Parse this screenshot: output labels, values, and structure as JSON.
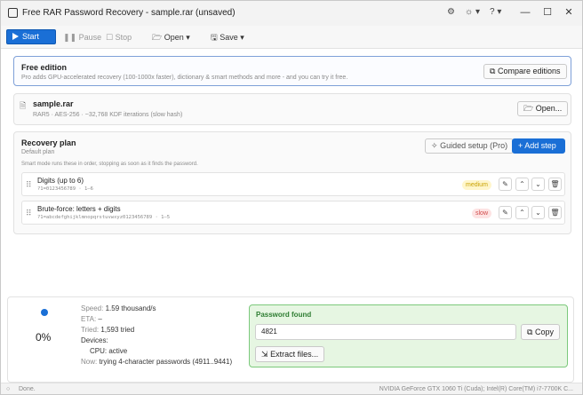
{
  "window": {
    "title": "Free RAR Password Recovery - sample.rar (unsaved)",
    "icons": [
      "gear-icon",
      "theme-icon",
      "help-icon"
    ],
    "controls": [
      "minimize-icon",
      "maximize-icon",
      "close-icon"
    ]
  },
  "toolbar": {
    "start": "Start",
    "pause": "Pause",
    "stop": "Stop",
    "open": "Open",
    "save": "Save"
  },
  "edition": {
    "title": "Free edition",
    "description": "Pro adds GPU-accelerated recovery (100-1000x faster), dictionary & smart methods and more - and you can try it free.",
    "compare": "Compare editions"
  },
  "archive": {
    "name": "sample.rar",
    "details": "RAR5 · AES-256 · ~32,768 KDF iterations (slow hash)",
    "open": "Open..."
  },
  "plan": {
    "title": "Recovery plan",
    "subtitle": "Default plan",
    "guided": "Guided setup (Pro)",
    "add": "Add step",
    "hint": "Smart mode runs these in order, stopping as soon as it finds the password.",
    "steps": [
      {
        "name": "Digits (up to 6)",
        "detail": "?1=0123456789 · 1–6",
        "speed": "medium",
        "speed_color": "#c9a100",
        "speed_bg": "#fff6cc"
      },
      {
        "name": "Brute-force: letters + digits",
        "detail": "?1=abcdefghijklmnopqrstuvwxyz0123456789 · 1–5",
        "speed": "slow",
        "speed_color": "#d14a4a",
        "speed_bg": "#fde3e3"
      }
    ]
  },
  "progress": {
    "percent": "0%",
    "speed_label": "Speed:",
    "speed_value": "1.59 thousand/s",
    "eta_label": "ETA:",
    "eta_value": "–",
    "tried_label": "Tried:",
    "tried_value": "1,593 tried",
    "devices_label": "Devices:",
    "device": "CPU: active",
    "now_label": "Now:",
    "now_value": "trying 4-character passwords  (4911..9441)"
  },
  "found": {
    "title": "Password found",
    "password": "4821",
    "copy": "Copy",
    "extract": "Extract files..."
  },
  "status": {
    "text": "Done.",
    "hardware": "NVIDIA GeForce GTX 1060 Ti (Cuda); Intel(R) Core(TM) i7-7700K C..."
  },
  "colors": {
    "accent": "#1a6fd6",
    "found_bg": "#e6f6e2",
    "found_border": "#7cc97c"
  }
}
